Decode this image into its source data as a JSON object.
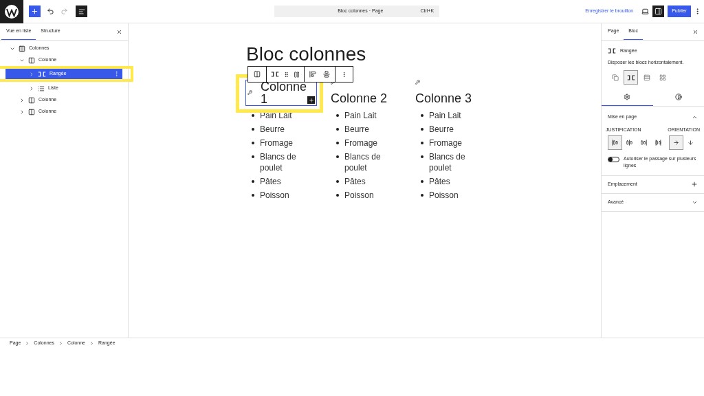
{
  "topbar": {
    "title": "Bloc colonnes · Page",
    "shortcut": "Ctrl+K",
    "save_draft": "Enregistrer le brouillon",
    "publish": "Publier"
  },
  "left_panel": {
    "tabs": [
      {
        "label": "Vue en liste",
        "selected": true
      },
      {
        "label": "Structure",
        "selected": false
      }
    ],
    "tree": [
      {
        "label": "Colonnes",
        "kind": "columns",
        "expanded": true,
        "selected": false,
        "children": [
          {
            "label": "Colonne",
            "kind": "column",
            "expanded": true,
            "selected": false,
            "children": [
              {
                "label": "Rangée",
                "kind": "row",
                "expanded": false,
                "selected": true
              },
              {
                "label": "Liste",
                "kind": "list",
                "expanded": false,
                "selected": false
              }
            ]
          },
          {
            "label": "Colonne",
            "kind": "column",
            "expanded": false,
            "selected": false
          },
          {
            "label": "Colonne",
            "kind": "column",
            "expanded": false,
            "selected": false
          }
        ]
      }
    ]
  },
  "content": {
    "title": "Bloc colonnes",
    "columns": [
      {
        "heading": "Colonne 1",
        "selected": true,
        "items": [
          "Pain Lait",
          "Beurre",
          "Fromage",
          "Blancs de poulet",
          "Pâtes",
          "Poisson"
        ]
      },
      {
        "heading": "Colonne 2",
        "selected": false,
        "items": [
          "Pain Lait",
          "Beurre",
          "Fromage",
          "Blancs de poulet",
          "Pâtes",
          "Poisson"
        ]
      },
      {
        "heading": "Colonne 3",
        "selected": false,
        "items": [
          "Pain Lait",
          "Beurre",
          "Fromage",
          "Blancs de poulet",
          "Pâtes",
          "Poisson"
        ]
      }
    ]
  },
  "breadcrumb": [
    "Page",
    "Colonnes",
    "Colonne",
    "Rangée"
  ],
  "right_panel": {
    "tabs": [
      {
        "label": "Page",
        "selected": false
      },
      {
        "label": "Bloc",
        "selected": true
      }
    ],
    "block": {
      "name": "Rangée",
      "description": "Disposer les blocs horizontalement."
    },
    "variations": [
      {
        "kind": "group",
        "selected": false
      },
      {
        "kind": "row",
        "selected": true
      },
      {
        "kind": "stack",
        "selected": false
      },
      {
        "kind": "grid",
        "selected": false
      }
    ],
    "subtabs": [
      {
        "kind": "settings",
        "selected": true
      },
      {
        "kind": "styles",
        "selected": false
      }
    ],
    "layout": {
      "title": "Mise en page",
      "expanded": true,
      "justification_label": "JUSTIFICATION",
      "justification": [
        {
          "kind": "left",
          "selected": true
        },
        {
          "kind": "center",
          "selected": false
        },
        {
          "kind": "right",
          "selected": false
        },
        {
          "kind": "space",
          "selected": false
        }
      ],
      "orientation_label": "ORIENTATION",
      "orientation": [
        {
          "kind": "horizontal",
          "selected": true
        },
        {
          "kind": "vertical",
          "selected": false
        }
      ],
      "wrap": {
        "label": "Autoriser le passage sur plusieurs lignes",
        "on": false
      }
    },
    "sections": [
      {
        "title": "Emplacement",
        "kind": "plus"
      },
      {
        "title": "Avancé",
        "kind": "chevron"
      }
    ]
  }
}
